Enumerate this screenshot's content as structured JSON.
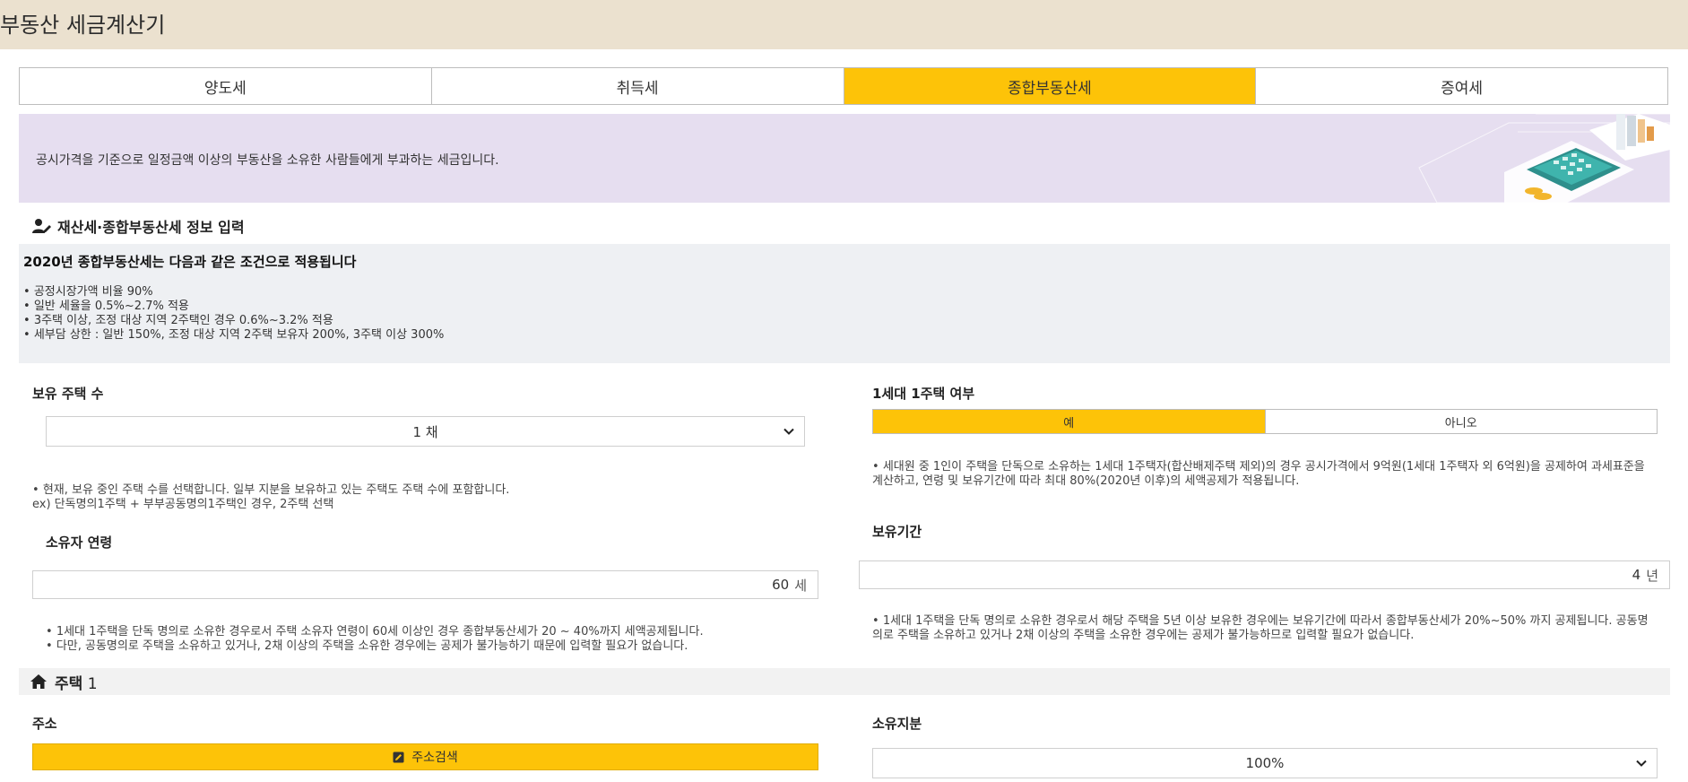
{
  "header": {
    "title": "부동산 세금계산기"
  },
  "tabs": [
    {
      "label": "양도세",
      "active": false
    },
    {
      "label": "취득세",
      "active": false
    },
    {
      "label": "종합부동산세",
      "active": true
    },
    {
      "label": "증여세",
      "active": false
    }
  ],
  "banner": {
    "text": "공시가격을 기준으로 일정금액 이상의 부동산을 소유한 사람들에게 부과하는 세금입니다."
  },
  "section": {
    "title": "재산세·종합부동산세 정보 입력"
  },
  "notice": {
    "title": "2020년 종합부동산세는 다음과 같은 조건으로 적용됩니다",
    "items": [
      "공정시장가액 비율 90%",
      "일반 세율을 0.5%~2.7% 적용",
      "3주택 이상, 조정 대상 지역 2주택인 경우 0.6%~3.2% 적용",
      "세부담 상한 : 일반 150%, 조정 대상 지역 2주택 보유자 200%, 3주택 이상 300%"
    ]
  },
  "house_count": {
    "label": "보유 주택 수",
    "value": "1 채",
    "help1": "현재, 보유 중인 주택 수를 선택합니다. 일부 지분을 보유하고 있는 주택도 주택 수에 포함합니다.",
    "help2": "ex) 단독명의1주택 + 부부공동명의1주택인 경우, 2주택 선택"
  },
  "one_house": {
    "label": "1세대 1주택 여부",
    "options": [
      "예",
      "아니오"
    ],
    "help": "세대원 중 1인이 주택을 단독으로 소유하는 1세대 1주택자(합산배제주택 제외)의 경우 공시가격에서 9억원(1세대 1주택자 외 6억원)을 공제하여 과세표준을 계산하고, 연령 및 보유기간에 따라 최대 80%(2020년 이후)의 세액공제가 적용됩니다."
  },
  "owner_age": {
    "label": "소유자 연령",
    "value": "60",
    "unit": "세",
    "help1": "1세대 1주택을 단독 명의로 소유한 경우로서 주택 소유자 연령이 60세 이상인 경우 종합부동산세가 20 ~ 40%까지 세액공제됩니다.",
    "help2": "다만, 공동명의로 주택을 소유하고 있거나, 2채 이상의 주택을 소유한 경우에는 공제가 불가능하기 때문에 입력할 필요가 없습니다."
  },
  "holding_period": {
    "label": "보유기간",
    "value": "4",
    "unit": "년",
    "help": "1세대 1주택을 단독 명의로 소유한 경우로서 해당 주택을 5년 이상 보유한 경우에는 보유기간에 따라서 종합부동산세가 20%~50% 까지 공제됩니다. 공동명의로 주택을 소유하고 있거나 2채 이상의 주택을 소유한 경우에는 공제가 불가능하므로 입력할 필요가 없습니다."
  },
  "house1": {
    "title": "주택",
    "number": "1",
    "address_label": "주소",
    "address_button": "주소검색",
    "share_label": "소유지분",
    "share_value": "100%"
  },
  "colors": {
    "accent": "#fdc308",
    "header_bg": "#ebe1cf",
    "banner_bg": "#e6def0",
    "notice_bg": "#eef0f3"
  },
  "icons": [
    "user-edit-icon",
    "chevron-down-icon",
    "home-icon",
    "edit-icon"
  ]
}
